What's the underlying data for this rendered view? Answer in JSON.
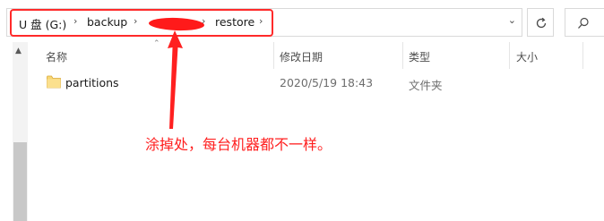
{
  "address_bar": {
    "crumbs": [
      "U 盘 (G:)",
      "backup",
      "restore"
    ],
    "separator": "›",
    "dropdown_glyph": "⌄"
  },
  "toolbar": {
    "refresh_icon": "refresh-icon",
    "search_icon": "search-icon"
  },
  "columns": [
    "名称",
    "修改日期",
    "类型",
    "大小"
  ],
  "files": [
    {
      "name": "partitions",
      "modified": "2020/5/19 18:43",
      "type": "文件夹",
      "size": ""
    }
  ],
  "annotation": {
    "text": "涂掉处，每台机器都不一样。",
    "color": "#ff2020"
  }
}
